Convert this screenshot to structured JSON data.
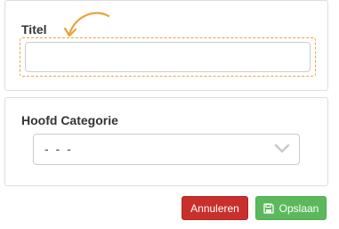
{
  "form": {
    "title_field": {
      "label": "Titel",
      "value": "",
      "placeholder": ""
    },
    "category_field": {
      "label": "Hoofd Categorie",
      "selected": "- - -"
    }
  },
  "actions": {
    "cancel_label": "Annuleren",
    "save_label": "Opslaan"
  },
  "icons": {
    "arrow": "curved-arrow-icon",
    "chevron": "chevron-down-icon",
    "save": "floppy-disk-icon"
  },
  "colors": {
    "highlight": "#e8a33d",
    "cancel": "#c9302c",
    "save": "#5cb85c"
  }
}
